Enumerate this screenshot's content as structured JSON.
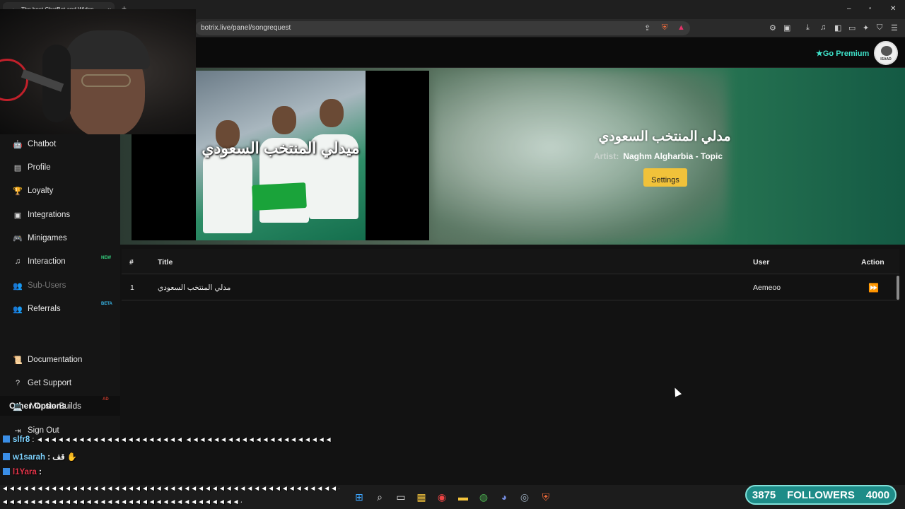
{
  "browser": {
    "tab_title": "The best ChatBot and Widge",
    "tab_close": "×",
    "new_tab": "+",
    "url": "botrix.live/panel/songrequest",
    "window_controls": [
      "–",
      "▫",
      "✕"
    ]
  },
  "topnav": {
    "premium_label": "Go Premium",
    "premium_icon": "star-icon",
    "avatar_text": "ISAAD"
  },
  "sidebar": {
    "items": [
      {
        "label": "Chatbot",
        "icon": "robot-icon",
        "glyph": "🤖"
      },
      {
        "label": "Profile",
        "icon": "id-card-icon",
        "glyph": "▤"
      },
      {
        "label": "Loyalty",
        "icon": "trophy-icon",
        "glyph": "🏆"
      },
      {
        "label": "Integrations",
        "icon": "integrations-icon",
        "glyph": "▣"
      },
      {
        "label": "Minigames",
        "icon": "gamepad-icon",
        "glyph": "🎮"
      },
      {
        "label": "Interaction",
        "icon": "music-icon",
        "glyph": "♫",
        "badge": "NEW"
      },
      {
        "label": "Sub-Users",
        "icon": "users-icon",
        "glyph": "👥",
        "disabled": true
      },
      {
        "label": "Referrals",
        "icon": "referrals-icon",
        "glyph": "👥",
        "badge": "BETA"
      }
    ],
    "other_title": "Other Options",
    "other_items": [
      {
        "label": "Documentation",
        "icon": "document-icon",
        "glyph": "📜"
      },
      {
        "label": "Get Support",
        "icon": "question-icon",
        "glyph": "?"
      },
      {
        "label": "MonsterBuilds",
        "icon": "laptop-icon",
        "glyph": "💻",
        "badge": "AD"
      },
      {
        "label": "Sign Out",
        "icon": "sign-out-icon",
        "glyph": "⇥"
      }
    ],
    "badge_colors": {
      "NEW": "#35d07f",
      "BETA": "#38b6e8",
      "AD": "#c0392b"
    }
  },
  "player": {
    "thumbnail_text": "ميدلي المنتخب السعودي",
    "song_title": "مدلي المنتخب السعودي",
    "artist_label": "Artist:",
    "artist": "Naghm Algharbia - Topic",
    "settings_label": "Settings"
  },
  "queue": {
    "columns": [
      "#",
      "Title",
      "User",
      "Action"
    ],
    "rows": [
      {
        "index": "1",
        "title": "مدلي المنتخب السعودي",
        "user": "Aemeoo",
        "action_icon": "skip-forward-icon"
      }
    ]
  },
  "chat": {
    "lines": [
      {
        "user": "slfr8",
        "color": "#7fd3ff",
        "text": ": ◄◄◄◄◄◄◄◄◄◄◄◄◄◄◄◄◄◄◄◄◄ ◄◄◄◄◄◄◄◄◄◄◄◄◄◄◄◄◄◄◄◄◄"
      },
      {
        "user": "w1sarah",
        "color": "#7fd3ff",
        "text": ": قف ✋"
      },
      {
        "user": "l1Yara",
        "color": "#e6354a",
        "text": ":"
      }
    ],
    "stream_1": "◄◄◄◄◄◄◄◄◄◄◄◄◄◄◄◄◄◄◄◄◄◄◄◄◄◄◄◄◄◄◄◄◄◄◄◄◄◄◄◄◄◄◄◄◄◄◄◄◄◄◄◄◄◄◄◄◄◄",
    "stream_2": "◄◄◄◄◄◄◄◄◄◄◄◄◄◄◄◄◄◄◄◄◄◄◄◄◄◄◄◄◄◄◄◄◄◄◄◄◄◄◄◄◄◄◄"
  },
  "followers": {
    "current": "3875",
    "label": "FOLLOWERS",
    "goal": "4000"
  },
  "colors": {
    "accent": "#3ee0c8",
    "settings_button": "#f1c23a",
    "background": "#121212"
  }
}
